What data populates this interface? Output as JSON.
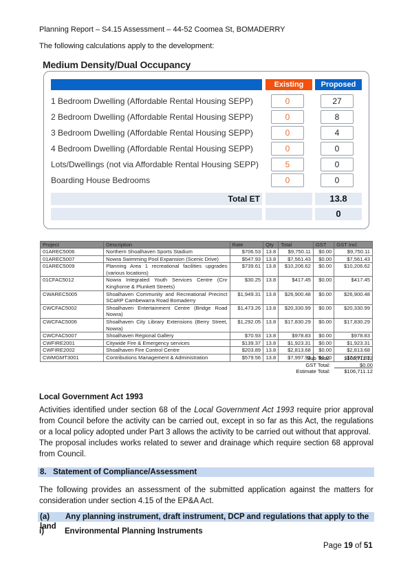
{
  "header": {
    "text": "Planning Report – S4.15 Assessment – 44-52 Coomea St, BOMADERRY"
  },
  "intro": "The following calculations apply to the development:",
  "calculator": {
    "title": "Medium Density/Dual Occupancy",
    "col_existing": "Existing",
    "col_proposed": "Proposed",
    "colors": {
      "existing": "#f2510e",
      "proposed": "#0a64c8"
    },
    "rows": [
      {
        "label": "1 Bedroom Dwelling (Affordable Rental Housing SEPP)",
        "existing": "0",
        "proposed": "27"
      },
      {
        "label": "2 Bedroom Dwelling (Affordable Rental Housing SEPP)",
        "existing": "0",
        "proposed": "8"
      },
      {
        "label": "3 Bedroom Dwelling (Affordable Rental Housing SEPP)",
        "existing": "0",
        "proposed": "4"
      },
      {
        "label": "4 Bedroom Dwelling (Affordable Rental Housing SEPP)",
        "existing": "0",
        "proposed": "0"
      },
      {
        "label": "Lots/Dwellings (not via Affordable Rental Housing SEPP)",
        "existing": "5",
        "proposed": "0"
      },
      {
        "label": "Boarding House Bedrooms",
        "existing": "0",
        "proposed": "0"
      }
    ],
    "total_label": "Total ET",
    "total_value": "13.8",
    "second_total_value": "0"
  },
  "contributions": {
    "headers": [
      "Project",
      "Description",
      "Rate",
      "Qty",
      "Total",
      "GST",
      "GST Incl"
    ],
    "rows": [
      [
        "01AREC5006",
        "Northern Shoalhaven Sports Stadium",
        "$706.53",
        "13.8",
        "$9,750.11",
        "$0.00",
        "$9,750.11"
      ],
      [
        "01AREC5007",
        "Nowra Swimming Pool Expansion (Scenic Drive)",
        "$547.93",
        "13.8",
        "$7,561.43",
        "$0.00",
        "$7,561.43"
      ],
      [
        "01AREC5009",
        "Planning Area 1 recreational facilities upgrades (various locations)",
        "$739.61",
        "13.8",
        "$10,206.62",
        "$0.00",
        "$10,206.62"
      ],
      [
        "01CFAC5012",
        "Nowra Integrated Youth Services Centre (Cnr Kinghorne & Plunkett Streets)",
        "$30.25",
        "13.8",
        "$417.45",
        "$0.00",
        "$417.45"
      ],
      [
        "CWAREC5005",
        "Shoalhaven Community and Recreational Precinct SCaRP Cambewarra Road Bomaderry",
        "$1,949.31",
        "13.8",
        "$26,900.48",
        "$0.00",
        "$26,900.48"
      ],
      [
        "CWCFAC5002",
        "Shoalhaven Entertainment Centre (Bridge Road Nowra)",
        "$1,473.26",
        "13.8",
        "$20,330.99",
        "$0.00",
        "$20,330.99"
      ],
      [
        "CWCFAC5006",
        "Shoalhaven City Library Extensions (Berry Street, Nowra)",
        "$1,292.05",
        "13.8",
        "$17,830.29",
        "$0.00",
        "$17,830.29"
      ],
      [
        "CWCFAC5007",
        "Shoalhaven Regional Gallery",
        "$70.93",
        "13.8",
        "$978.83",
        "$0.00",
        "$978.83"
      ],
      [
        "CWFIRE2001",
        "Citywide Fire & Emergency services",
        "$139.37",
        "13.8",
        "$1,923.31",
        "$0.00",
        "$1,923.31"
      ],
      [
        "CWFIRE2002",
        "Shoalhaven Fire Control Centre",
        "$203.89",
        "13.8",
        "$2,813.68",
        "$0.00",
        "$2,813.68"
      ],
      [
        "CWMGMT3001",
        "Contributions Management & Administration",
        "$579.56",
        "13.8",
        "$7,997.93",
        "$0.00",
        "$7,997.93"
      ]
    ],
    "totals": [
      {
        "label": "Sub Total:",
        "value": "$106,711.12"
      },
      {
        "label": "GST Total:",
        "value": "$0.00"
      },
      {
        "label": "Estimate Total:",
        "value": "$106,711.12"
      }
    ]
  },
  "lga": {
    "title": "Local Government Act 1993",
    "para1_before": "Activities identified under section 68 of the ",
    "para1_italic": "Local Government Act 1993",
    "para1_after": " require prior approval from Council before the activity can be carried out, except in so far as this Act, the regulations or a local policy adopted under Part 3 allows the activity to be carried out without that approval.",
    "para2": "The proposal includes works related to sewer and drainage which require section 68 approval from Council."
  },
  "section8": {
    "title": "8.   Statement of Compliance/Assessment",
    "para": "The following provides an assessment of the submitted application against the matters for consideration under section 4.15 of the EP&A Act.",
    "sub_a_label": "(a)",
    "sub_a_text": "Any planning instrument, draft instrument, DCP and regulations that apply to the land",
    "sub_i_label": "i)",
    "sub_i_text": "Environmental Planning Instruments"
  },
  "footer": {
    "page_prefix": "Page ",
    "page_current": "19",
    "page_mid": " of ",
    "page_total": "51"
  }
}
